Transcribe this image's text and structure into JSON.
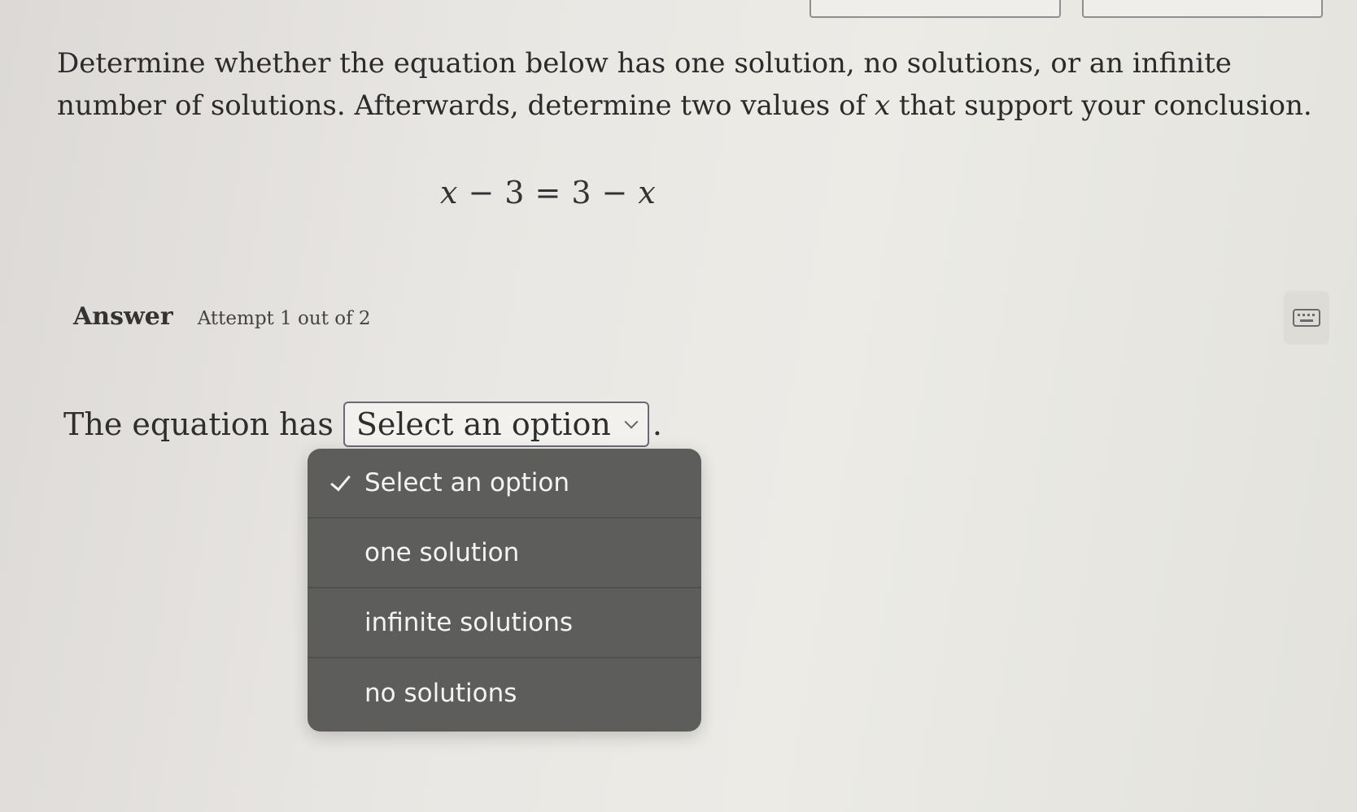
{
  "question": {
    "text_part1": "Determine whether the equation below has one solution, no solutions, or an infinite number of solutions. Afterwards, determine two values of ",
    "variable": "x",
    "text_part2": " that support your conclusion."
  },
  "equation": {
    "lhs_var": "x",
    "minus1": "−",
    "lhs_num": "3",
    "equals": "=",
    "rhs_num": "3",
    "minus2": "−",
    "rhs_var": "x"
  },
  "answer": {
    "label": "Answer",
    "attempt": "Attempt 1 out of 2"
  },
  "response": {
    "prefix": "The equation has",
    "selected": "Select an option",
    "suffix": "."
  },
  "dropdown": {
    "options": [
      {
        "label": "Select an option",
        "checked": true
      },
      {
        "label": "one solution",
        "checked": false
      },
      {
        "label": "infinite solutions",
        "checked": false
      },
      {
        "label": "no solutions",
        "checked": false
      }
    ]
  }
}
